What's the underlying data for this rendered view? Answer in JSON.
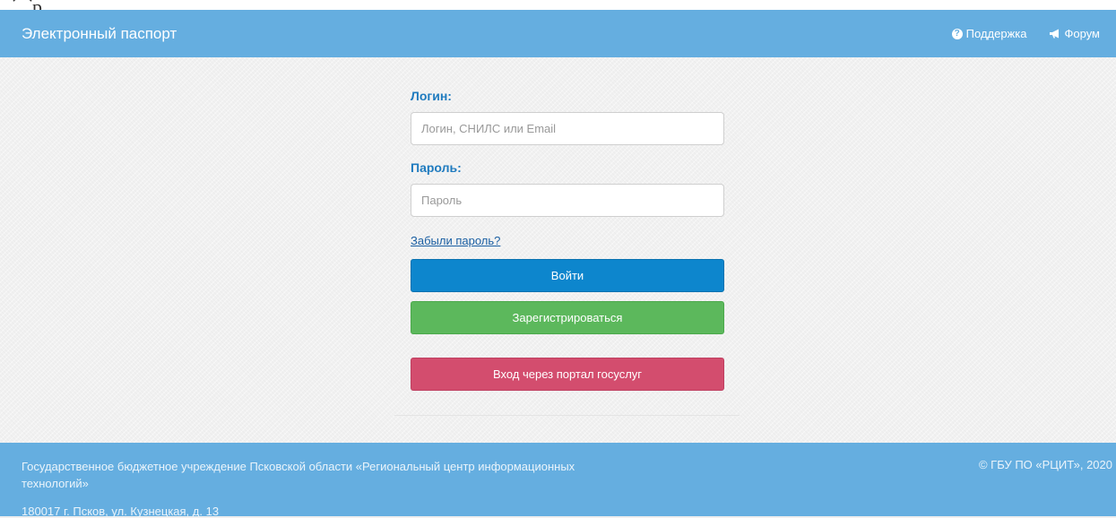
{
  "header": {
    "brand": "Электронный паспорт",
    "nav": [
      {
        "label": "Поддержка",
        "icon": "question-circle-icon"
      },
      {
        "label": "Форум",
        "icon": "megaphone-icon"
      }
    ]
  },
  "login": {
    "login_label": "Логин:",
    "login_placeholder": "Логин, СНИЛС или Email",
    "password_label": "Пароль:",
    "password_placeholder": "Пароль",
    "forgot_link": "Забыли пароль?",
    "login_button": "Войти",
    "register_button": "Зарегистрироваться",
    "gosuslugi_button": "Вход через портал госуслуг"
  },
  "footer": {
    "organization": "Государственное бюджетное учреждение Псковской области «Региональный центр информационных технологий»",
    "address": "180017 г. Псков, ул. Кузнецкая, д. 13",
    "copyright": "© ГБУ ПО «РЦИТ», 2020"
  },
  "colors": {
    "navbar": "#65aee0",
    "label": "#1f7bbf",
    "login_button": "#0d86cd",
    "register_button": "#5cb85c",
    "gosuslugi_button": "#d34d6e"
  }
}
